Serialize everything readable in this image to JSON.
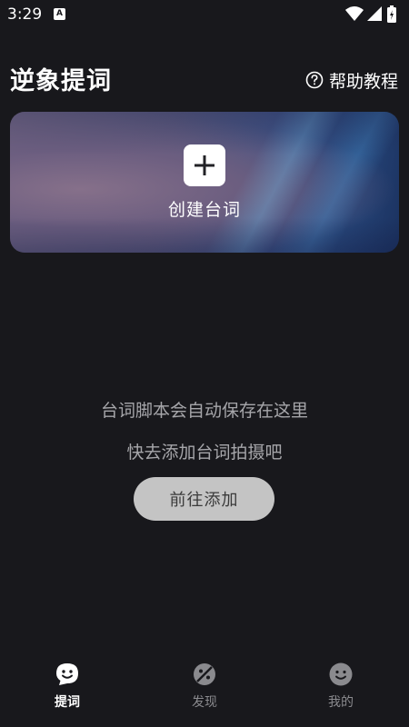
{
  "status_bar": {
    "time": "3:29",
    "notification_letter": "A",
    "icons": [
      "wifi-icon",
      "signal-icon",
      "battery-icon"
    ]
  },
  "header": {
    "title": "逆象提词",
    "help_label": "帮助教程",
    "help_icon": "question-circle-icon"
  },
  "create_card": {
    "label": "创建台词",
    "icon": "plus-icon"
  },
  "empty_state": {
    "line1": "台词脚本会自动保存在这里",
    "line2": "快去添加台词拍摄吧",
    "button_label": "前往添加"
  },
  "bottom_nav": {
    "items": [
      {
        "label": "提词",
        "icon": "teleprompter-icon",
        "active": true
      },
      {
        "label": "发现",
        "icon": "discover-icon",
        "active": false
      },
      {
        "label": "我的",
        "icon": "smiley-icon",
        "active": false
      }
    ]
  },
  "colors": {
    "background": "#18181c",
    "text_primary": "#ffffff",
    "text_secondary": "#a6a6aa",
    "nav_inactive": "#8a8a8e",
    "button_bg": "#c4c4c4"
  }
}
